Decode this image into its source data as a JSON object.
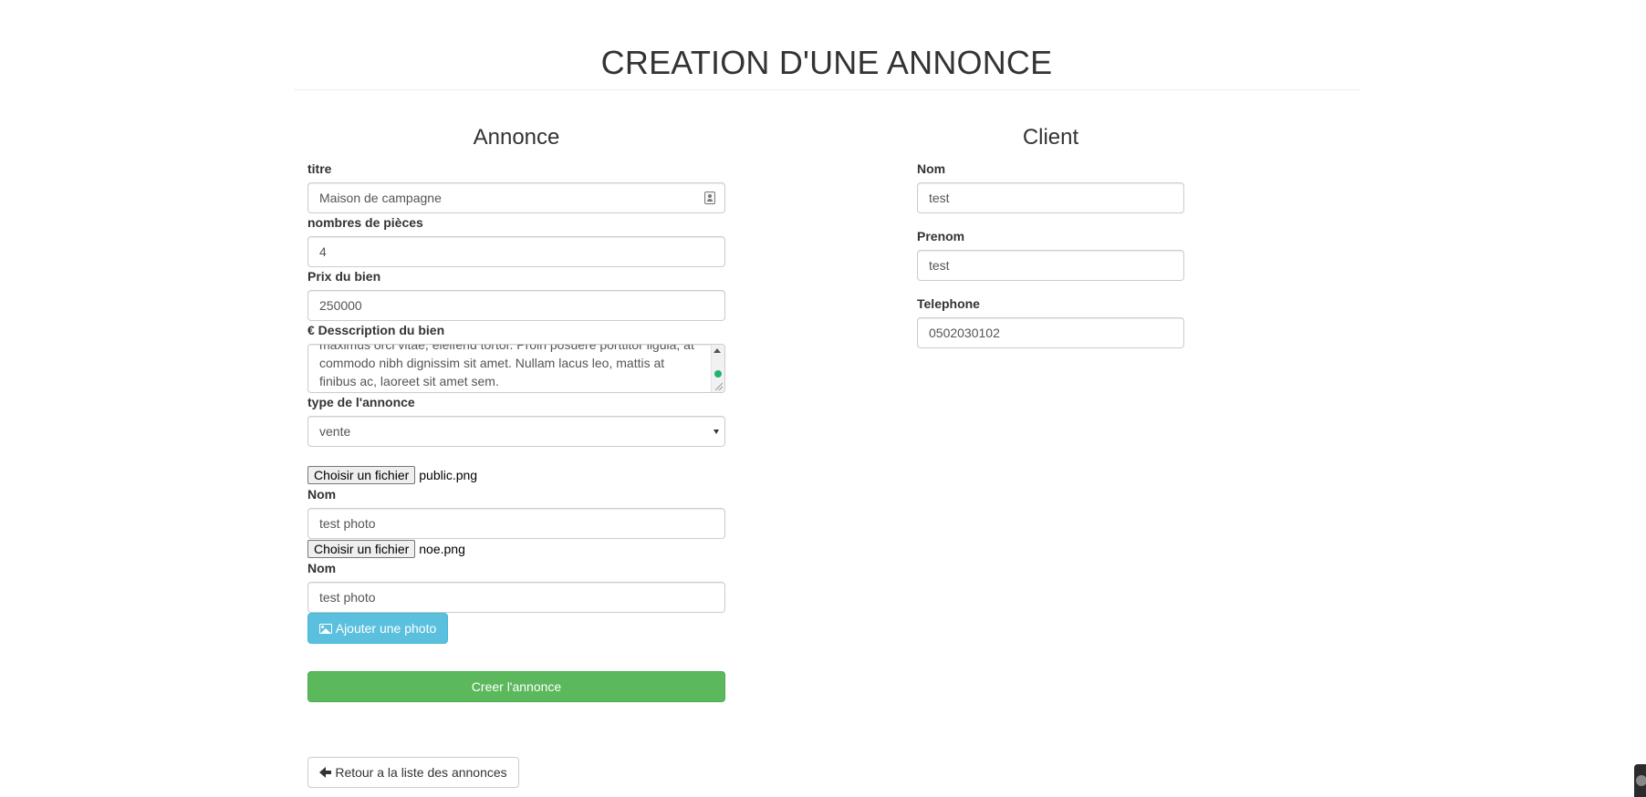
{
  "page": {
    "title": "CREATION D'UNE ANNONCE"
  },
  "annonce": {
    "section_title": "Annonce",
    "titre": {
      "label": "titre",
      "value": "Maison de campagne"
    },
    "pieces": {
      "label": "nombres de pièces",
      "value": "4"
    },
    "prix": {
      "label": "Prix du bien",
      "value": "250000"
    },
    "description": {
      "label": "€ Desscription du bien",
      "value": "maximus orci vitae, eleifend tortor. Proin posuere porttitor ligula, at commodo nibh dignissim sit amet. Nullam lacus leo, mattis at finibus ac, laoreet sit amet sem."
    },
    "type": {
      "label": "type de l'annonce",
      "selected": "vente"
    },
    "photos": [
      {
        "button_label": "Choisir un fichier",
        "file_name": "public.png",
        "name_label": "Nom",
        "name_value": "test photo"
      },
      {
        "button_label": "Choisir un fichier",
        "file_name": "noe.png",
        "name_label": "Nom",
        "name_value": "test photo"
      }
    ],
    "add_photo_label": "Ajouter une photo",
    "submit_label": "Creer l'annonce"
  },
  "client": {
    "section_title": "Client",
    "nom": {
      "label": "Nom",
      "value": "test"
    },
    "prenom": {
      "label": "Prenom",
      "value": "test"
    },
    "telephone": {
      "label": "Telephone",
      "value": "0502030102"
    }
  },
  "back_link_label": "Retour a la liste des annonces",
  "colors": {
    "text": "#333333",
    "info_button": "#5bc0de",
    "success_button": "#5cb85c",
    "border": "#cccccc"
  },
  "icons": {
    "contact": "contact-card-icon",
    "photo": "picture-icon",
    "back": "arrow-left-icon",
    "select": "caret-down-icon"
  }
}
